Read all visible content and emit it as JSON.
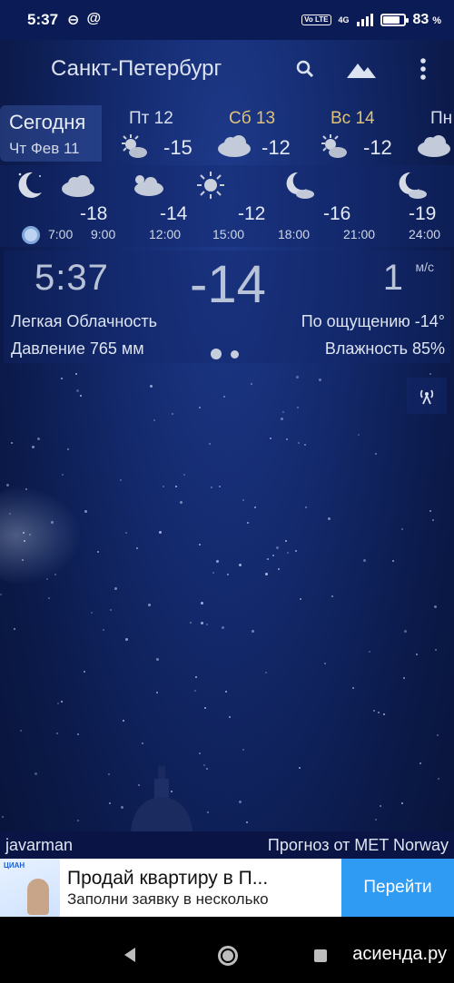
{
  "status_bar": {
    "time": "5:37",
    "network": "4G",
    "volte": "Vo LTE",
    "battery_percent": "83",
    "battery_suffix": "%",
    "battery_level": 0.83,
    "icons": [
      "link-icon",
      "at-icon"
    ]
  },
  "app_bar": {
    "city": "Санкт-Петербург",
    "search_icon": "search-icon",
    "background_icon": "landscape-icon",
    "menu_icon": "more-vert-icon"
  },
  "days": {
    "today": {
      "label": "Сегодня",
      "date": "Чт Фев 11"
    },
    "items": [
      {
        "name": "Пт 12",
        "temp": "-15",
        "icon": "sun-cloud-icon",
        "weekend": false
      },
      {
        "name": "Сб 13",
        "temp": "-12",
        "icon": "cloud-icon",
        "weekend": true
      },
      {
        "name": "Вс 14",
        "temp": "-12",
        "icon": "sun-cloud-icon",
        "weekend": true
      },
      {
        "name": "Пн",
        "temp": "",
        "icon": "cloud-icon",
        "weekend": false
      }
    ]
  },
  "hourly": [
    {
      "time": "7:00",
      "temp": "",
      "icon": "moon-icon"
    },
    {
      "time": "9:00",
      "temp": "-18",
      "icon": "cloud-icon"
    },
    {
      "time": "12:00",
      "temp": "-14",
      "icon": "sun-cloud-icon"
    },
    {
      "time": "15:00",
      "temp": "-12",
      "icon": "sun-icon"
    },
    {
      "time": "18:00",
      "temp": "-16",
      "icon": "moon-cloud-icon"
    },
    {
      "time": "21:00",
      "temp": "",
      "icon": ""
    },
    {
      "time": "24:00",
      "temp": "-19",
      "icon": "moon-cloud-icon"
    }
  ],
  "current": {
    "time": "5:37",
    "temp": "-14",
    "wind_speed": "1",
    "wind_unit": "м/с",
    "condition": "Легкая Облачность",
    "feels_like": "По ощущению -14°",
    "pressure": "Давление 765 мм",
    "humidity": "Влажность 85%"
  },
  "radar_icon": "radar-icon",
  "credits": {
    "author": "javarman",
    "source": "Прогноз от MET Norway"
  },
  "ad": {
    "brand": "ЦИАН",
    "title": "Продай квартиру в П...",
    "subtitle": "Заполни заявку в несколько",
    "button": "Перейти"
  },
  "watermark": "асиенда.ру",
  "colors": {
    "sky_top": "#1e3a8a",
    "sky_bottom": "#081235",
    "weekend_label": "#e0c27a",
    "ad_button": "#2f9bf2"
  }
}
